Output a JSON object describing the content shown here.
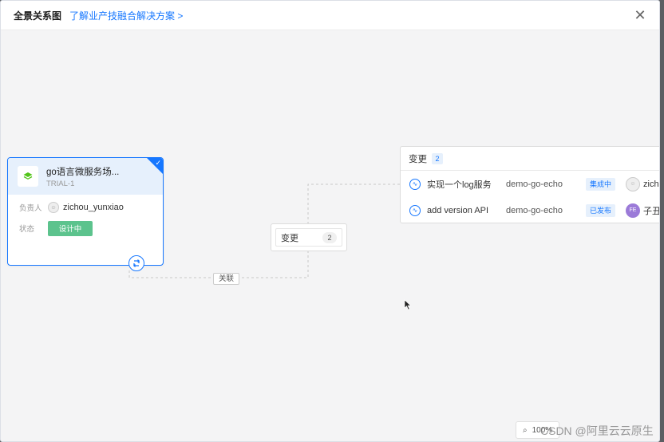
{
  "modal": {
    "title": "全景关系图",
    "link": "了解业产技融合解决方案 >",
    "close": "✕"
  },
  "main_card": {
    "title": "go语言微服务场...",
    "subtitle": "TRIAL-1",
    "owner_label": "负责人",
    "owner_name": "zichou_yunxiao",
    "status_label": "状态",
    "status_value": "设计中"
  },
  "relation_label": "关联",
  "change_node": {
    "label": "变更",
    "count": "2"
  },
  "changes_panel": {
    "title": "变更",
    "count": "2",
    "rows": [
      {
        "name": "实现一个log服务",
        "app": "demo-go-echo",
        "status": "集成中",
        "owner": "zich"
      },
      {
        "name": "add version API",
        "app": "demo-go-echo",
        "status": "已发布",
        "avatar_text": "FE",
        "owner": "子丑"
      }
    ]
  },
  "zoom": {
    "value": "100%"
  },
  "watermark": "CSDN @阿里云云原生",
  "colors": {
    "accent": "#1677ff",
    "status_green": "#5cc38d",
    "canvas_bg": "#f4f4f5"
  }
}
